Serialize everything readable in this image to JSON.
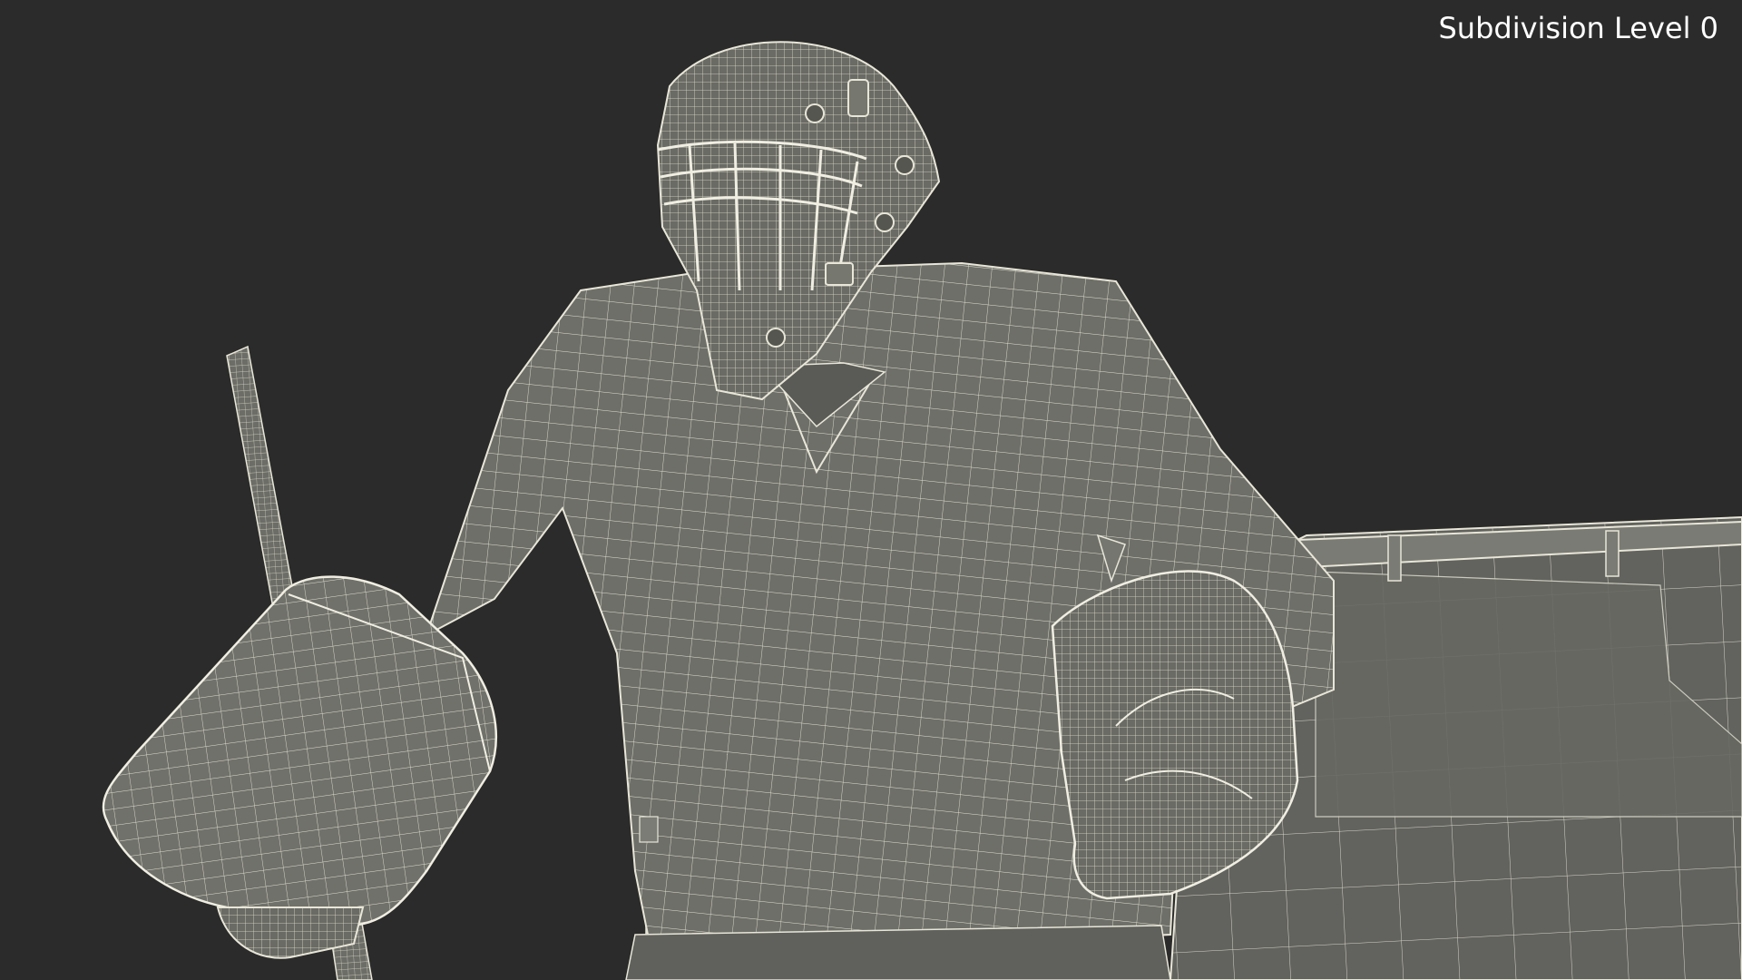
{
  "viewport": {
    "overlay_label": "Subdivision Level 0",
    "background_color": "#2b2b2b",
    "mesh_fill_color": "#6f706a",
    "mesh_dark_fill_color": "#5d5e59",
    "wireframe_color": "#e8e6d8"
  }
}
